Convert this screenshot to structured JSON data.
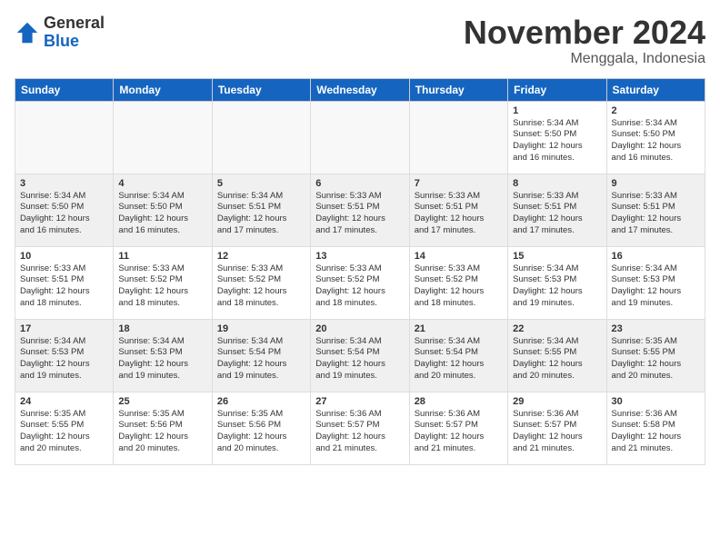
{
  "header": {
    "logo_line1": "General",
    "logo_line2": "Blue",
    "month": "November 2024",
    "location": "Menggala, Indonesia"
  },
  "days_of_week": [
    "Sunday",
    "Monday",
    "Tuesday",
    "Wednesday",
    "Thursday",
    "Friday",
    "Saturday"
  ],
  "weeks": [
    [
      {
        "day": "",
        "info": ""
      },
      {
        "day": "",
        "info": ""
      },
      {
        "day": "",
        "info": ""
      },
      {
        "day": "",
        "info": ""
      },
      {
        "day": "",
        "info": ""
      },
      {
        "day": "1",
        "info": "Sunrise: 5:34 AM\nSunset: 5:50 PM\nDaylight: 12 hours\nand 16 minutes."
      },
      {
        "day": "2",
        "info": "Sunrise: 5:34 AM\nSunset: 5:50 PM\nDaylight: 12 hours\nand 16 minutes."
      }
    ],
    [
      {
        "day": "3",
        "info": "Sunrise: 5:34 AM\nSunset: 5:50 PM\nDaylight: 12 hours\nand 16 minutes."
      },
      {
        "day": "4",
        "info": "Sunrise: 5:34 AM\nSunset: 5:50 PM\nDaylight: 12 hours\nand 16 minutes."
      },
      {
        "day": "5",
        "info": "Sunrise: 5:34 AM\nSunset: 5:51 PM\nDaylight: 12 hours\nand 17 minutes."
      },
      {
        "day": "6",
        "info": "Sunrise: 5:33 AM\nSunset: 5:51 PM\nDaylight: 12 hours\nand 17 minutes."
      },
      {
        "day": "7",
        "info": "Sunrise: 5:33 AM\nSunset: 5:51 PM\nDaylight: 12 hours\nand 17 minutes."
      },
      {
        "day": "8",
        "info": "Sunrise: 5:33 AM\nSunset: 5:51 PM\nDaylight: 12 hours\nand 17 minutes."
      },
      {
        "day": "9",
        "info": "Sunrise: 5:33 AM\nSunset: 5:51 PM\nDaylight: 12 hours\nand 17 minutes."
      }
    ],
    [
      {
        "day": "10",
        "info": "Sunrise: 5:33 AM\nSunset: 5:51 PM\nDaylight: 12 hours\nand 18 minutes."
      },
      {
        "day": "11",
        "info": "Sunrise: 5:33 AM\nSunset: 5:52 PM\nDaylight: 12 hours\nand 18 minutes."
      },
      {
        "day": "12",
        "info": "Sunrise: 5:33 AM\nSunset: 5:52 PM\nDaylight: 12 hours\nand 18 minutes."
      },
      {
        "day": "13",
        "info": "Sunrise: 5:33 AM\nSunset: 5:52 PM\nDaylight: 12 hours\nand 18 minutes."
      },
      {
        "day": "14",
        "info": "Sunrise: 5:33 AM\nSunset: 5:52 PM\nDaylight: 12 hours\nand 18 minutes."
      },
      {
        "day": "15",
        "info": "Sunrise: 5:34 AM\nSunset: 5:53 PM\nDaylight: 12 hours\nand 19 minutes."
      },
      {
        "day": "16",
        "info": "Sunrise: 5:34 AM\nSunset: 5:53 PM\nDaylight: 12 hours\nand 19 minutes."
      }
    ],
    [
      {
        "day": "17",
        "info": "Sunrise: 5:34 AM\nSunset: 5:53 PM\nDaylight: 12 hours\nand 19 minutes."
      },
      {
        "day": "18",
        "info": "Sunrise: 5:34 AM\nSunset: 5:53 PM\nDaylight: 12 hours\nand 19 minutes."
      },
      {
        "day": "19",
        "info": "Sunrise: 5:34 AM\nSunset: 5:54 PM\nDaylight: 12 hours\nand 19 minutes."
      },
      {
        "day": "20",
        "info": "Sunrise: 5:34 AM\nSunset: 5:54 PM\nDaylight: 12 hours\nand 19 minutes."
      },
      {
        "day": "21",
        "info": "Sunrise: 5:34 AM\nSunset: 5:54 PM\nDaylight: 12 hours\nand 20 minutes."
      },
      {
        "day": "22",
        "info": "Sunrise: 5:34 AM\nSunset: 5:55 PM\nDaylight: 12 hours\nand 20 minutes."
      },
      {
        "day": "23",
        "info": "Sunrise: 5:35 AM\nSunset: 5:55 PM\nDaylight: 12 hours\nand 20 minutes."
      }
    ],
    [
      {
        "day": "24",
        "info": "Sunrise: 5:35 AM\nSunset: 5:55 PM\nDaylight: 12 hours\nand 20 minutes."
      },
      {
        "day": "25",
        "info": "Sunrise: 5:35 AM\nSunset: 5:56 PM\nDaylight: 12 hours\nand 20 minutes."
      },
      {
        "day": "26",
        "info": "Sunrise: 5:35 AM\nSunset: 5:56 PM\nDaylight: 12 hours\nand 20 minutes."
      },
      {
        "day": "27",
        "info": "Sunrise: 5:36 AM\nSunset: 5:57 PM\nDaylight: 12 hours\nand 21 minutes."
      },
      {
        "day": "28",
        "info": "Sunrise: 5:36 AM\nSunset: 5:57 PM\nDaylight: 12 hours\nand 21 minutes."
      },
      {
        "day": "29",
        "info": "Sunrise: 5:36 AM\nSunset: 5:57 PM\nDaylight: 12 hours\nand 21 minutes."
      },
      {
        "day": "30",
        "info": "Sunrise: 5:36 AM\nSunset: 5:58 PM\nDaylight: 12 hours\nand 21 minutes."
      }
    ]
  ]
}
